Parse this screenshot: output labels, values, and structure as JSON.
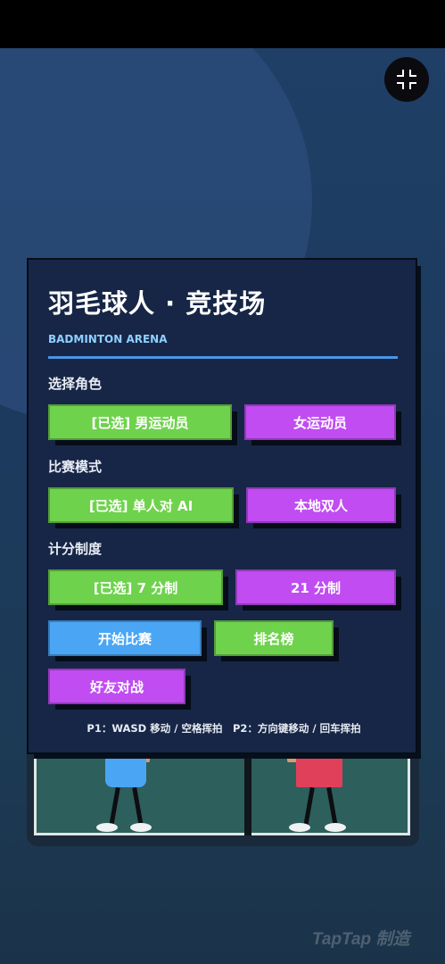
{
  "game": {
    "title": "羽毛球人 · 竞技场",
    "subtitle": "BADMINTON ARENA",
    "sections": {
      "character": {
        "label": "选择角色",
        "options": [
          "[已选] 男运动员",
          "女运动员"
        ]
      },
      "mode": {
        "label": "比赛模式",
        "options": [
          "[已选] 单人对 AI",
          "本地双人"
        ]
      },
      "scoring": {
        "label": "计分制度",
        "options": [
          "[已选] 7 分制",
          "21 分制"
        ]
      }
    },
    "actions": {
      "start": "开始比赛",
      "leaderboard": "排名榜",
      "friend_battle": "好友对战"
    },
    "controls_hint": "P1：WASD 移动 / 空格挥拍　P2：方向键移动 / 回车挥拍"
  },
  "watermark": "TapTap 制造",
  "icons": {
    "exit_fullscreen": "exit-fullscreen-icon"
  },
  "colors": {
    "selected": "#6fd24d",
    "unselected": "#c04cf2",
    "primary": "#4aa6f4",
    "panel": "#172646",
    "player1": "#4aa6f4",
    "player2": "#e0405a"
  }
}
